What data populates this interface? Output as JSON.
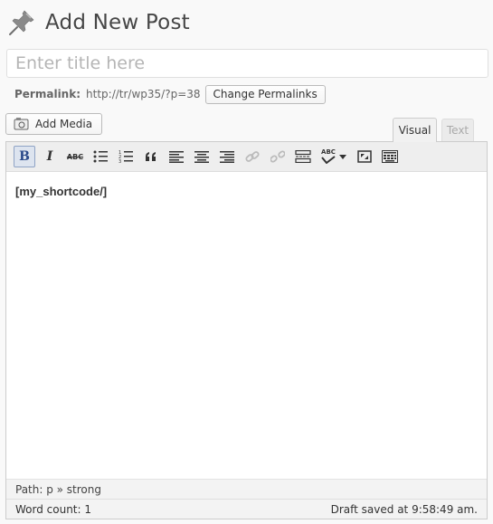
{
  "header": {
    "title": "Add New Post",
    "icon": "pushpin-icon"
  },
  "title_field": {
    "value": "",
    "placeholder": "Enter title here"
  },
  "permalink": {
    "label": "Permalink:",
    "url": "http://tr/wp35/?p=38",
    "button_label": "Change Permalinks"
  },
  "media": {
    "add_media_label": "Add Media"
  },
  "tabs": [
    {
      "label": "Visual",
      "active": true
    },
    {
      "label": "Text",
      "active": false
    }
  ],
  "toolbar": {
    "buttons": [
      "bold",
      "italic",
      "strikethrough",
      "bulleted-list",
      "numbered-list",
      "blockquote",
      "align-left",
      "align-center",
      "align-right",
      "insert-link",
      "remove-link",
      "insert-more",
      "spellcheck",
      "fullscreen",
      "kitchen-sink"
    ],
    "active": "bold",
    "bold_glyph": "B",
    "italic_glyph": "I",
    "strike_glyph": "ABC",
    "spell_glyph": "ABC"
  },
  "content": {
    "text": "[my_shortcode/]"
  },
  "path_bar": {
    "text": "Path: p » strong"
  },
  "status": {
    "word_count": "Word count: 1",
    "draft_saved": "Draft saved at 9:58:49 am."
  },
  "colors": {
    "accent": "#8fa3c5",
    "background": "#f9f9f9"
  }
}
